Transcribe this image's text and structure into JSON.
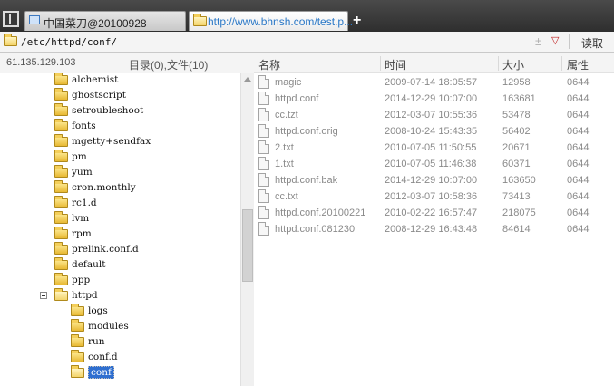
{
  "tabs": [
    {
      "label": "中国菜刀@20100928",
      "icon": "screen-icon"
    },
    {
      "label": "http://www.bhnsh.com/test.p...",
      "icon": "folder-icon"
    }
  ],
  "new_tab_label": "+",
  "address": {
    "path": "/etc/httpd/conf/",
    "history_symbol": "±",
    "dropdown_symbol": "▽",
    "read_label": "读取"
  },
  "server_ip": "61.135.129.103",
  "counts_label": "目录(0),文件(10)",
  "tree": [
    {
      "label": "alchemist"
    },
    {
      "label": "ghostscript"
    },
    {
      "label": "setroubleshoot"
    },
    {
      "label": "fonts"
    },
    {
      "label": "mgetty+sendfax"
    },
    {
      "label": "pm"
    },
    {
      "label": "yum"
    },
    {
      "label": "cron.monthly"
    },
    {
      "label": "rc1.d"
    },
    {
      "label": "lvm"
    },
    {
      "label": "rpm"
    },
    {
      "label": "prelink.conf.d"
    },
    {
      "label": "default"
    },
    {
      "label": "ppp"
    },
    {
      "label": "httpd",
      "expanded": true
    },
    {
      "label": "logs"
    },
    {
      "label": "modules"
    },
    {
      "label": "run"
    },
    {
      "label": "conf.d"
    },
    {
      "label": "conf",
      "selected": true
    }
  ],
  "columns": {
    "name": "名称",
    "time": "时间",
    "size": "大小",
    "attr": "属性"
  },
  "files": [
    {
      "name": "magic",
      "time": "2009-07-14 18:05:57",
      "size": "12958",
      "attr": "0644"
    },
    {
      "name": "httpd.conf",
      "time": "2014-12-29 10:07:00",
      "size": "163681",
      "attr": "0644"
    },
    {
      "name": "cc.tzt",
      "time": "2012-03-07 10:55:36",
      "size": "53478",
      "attr": "0644"
    },
    {
      "name": "httpd.conf.orig",
      "time": "2008-10-24 15:43:35",
      "size": "56402",
      "attr": "0644"
    },
    {
      "name": "2.txt",
      "time": "2010-07-05 11:50:55",
      "size": "20671",
      "attr": "0644"
    },
    {
      "name": "1.txt",
      "time": "2010-07-05 11:46:38",
      "size": "60371",
      "attr": "0644"
    },
    {
      "name": "httpd.conf.bak",
      "time": "2014-12-29 10:07:00",
      "size": "163650",
      "attr": "0644"
    },
    {
      "name": "cc.txt",
      "time": "2012-03-07 10:58:36",
      "size": "73413",
      "attr": "0644"
    },
    {
      "name": "httpd.conf.20100221",
      "time": "2010-02-22 16:57:47",
      "size": "218075",
      "attr": "0644"
    },
    {
      "name": "httpd.conf.081230",
      "time": "2008-12-29 16:43:48",
      "size": "84614",
      "attr": "0644"
    }
  ]
}
